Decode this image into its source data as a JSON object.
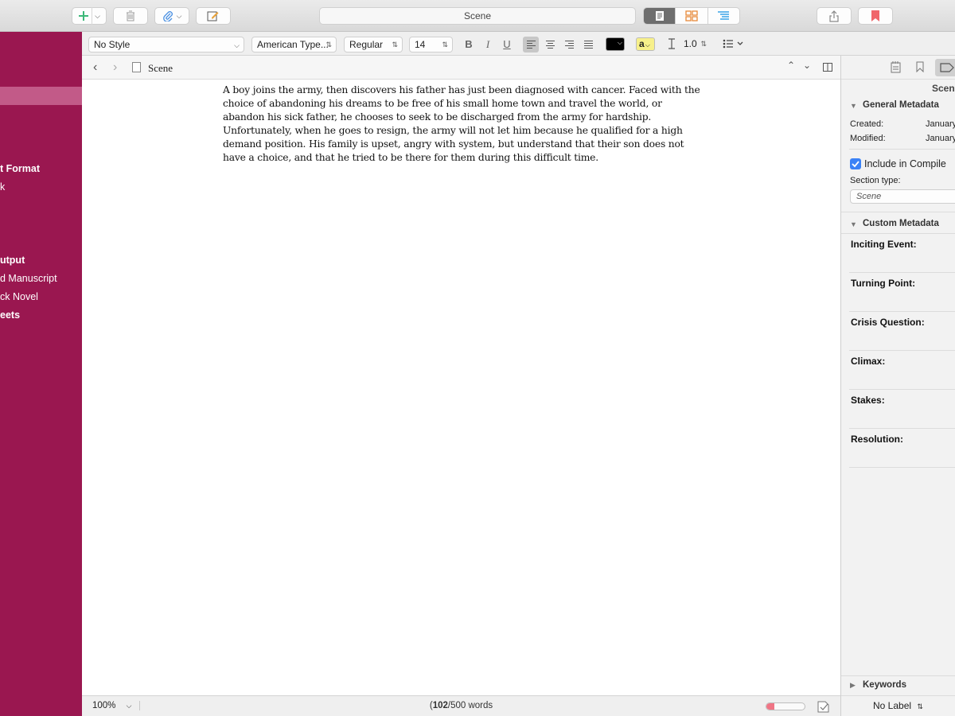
{
  "toolbar": {
    "title": "Scene",
    "icons": [
      "plus-icon",
      "trash-icon",
      "paperclip-icon",
      "compose-icon",
      "document-view-icon",
      "corkboard-icon",
      "outline-icon",
      "share-icon",
      "bookmark-icon"
    ],
    "colors": {
      "plus": "#3cb878",
      "paperclip": "#4a90e2",
      "compose": "#e8a23a",
      "corkboard": "#e88a3a",
      "outline": "#3aa3e8",
      "bookmark": "#f0666a",
      "active_segment": "#6e6e6e"
    }
  },
  "binder": {
    "background": "#9a1750",
    "selected_color": "#c25a88",
    "items": [
      {
        "label": "t Format",
        "bold": true
      },
      {
        "label": "k",
        "bold": false
      },
      {
        "label": "utput",
        "bold": true
      },
      {
        "label": "d Manuscript",
        "bold": false
      },
      {
        "label": "ck Novel",
        "bold": false
      },
      {
        "label": "eets",
        "bold": true
      }
    ]
  },
  "formatbar": {
    "style": "No Style",
    "font": "American Type...",
    "weight": "Regular",
    "size": "14",
    "bold": "B",
    "italic": "I",
    "underline": "U",
    "line_spacing": "1.0",
    "highlight_glyph": "a",
    "text_color": "#000000",
    "highlight_color": "#f7f08a"
  },
  "editor": {
    "doc_title": "Scene",
    "text": "A boy joins the army, then discovers his father has just been diagnosed with cancer. Faced with the choice of abandoning his dreams to be free of his small home town and travel the world, or abandon his sick father, he chooses to seek to be discharged from the army for hardship. Unfortunately, when he goes to resign, the army will not let him because he qualified for a high demand position. His family is upset, angry with system, but understand that their son does not have a choice, and that he tried to be there for them during this difficult time."
  },
  "footer": {
    "zoom": "100%",
    "word_count": "102",
    "word_target": "/500 words",
    "progress": 0.2
  },
  "inspector": {
    "title": "Scene",
    "general_metadata": "General Metadata",
    "created_label": "Created:",
    "created_value": "January",
    "modified_label": "Modified:",
    "modified_value": "January",
    "include_in_compile": "Include in Compile",
    "section_type_label": "Section type:",
    "section_type_value": "Scene",
    "custom_metadata": "Custom Metadata",
    "custom_fields": [
      "Inciting Event:",
      "Turning Point:",
      "Crisis Question:",
      "Climax:",
      "Stakes:",
      "Resolution:"
    ],
    "keywords": "Keywords",
    "label_value": "No Label"
  }
}
